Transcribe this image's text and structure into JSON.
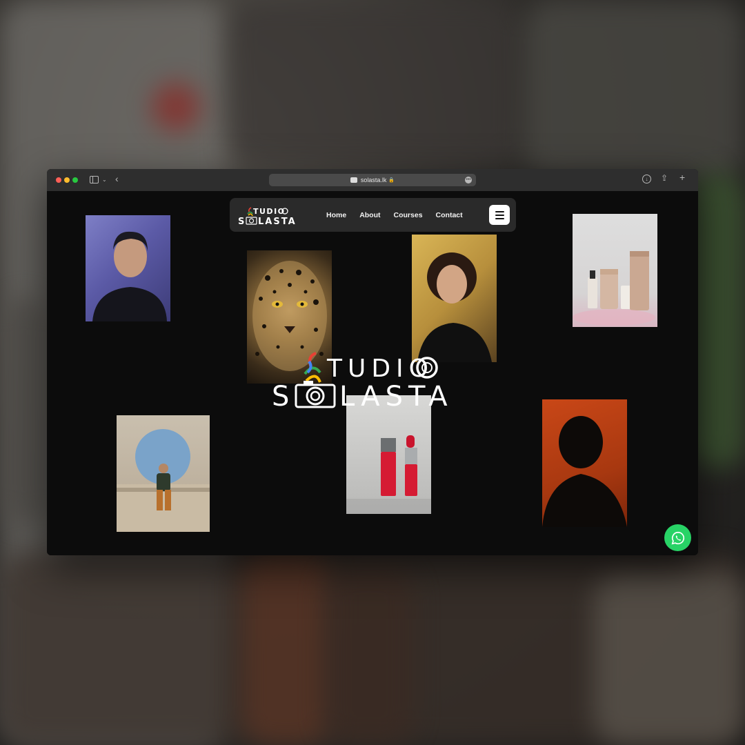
{
  "browser": {
    "url": "solasta.lk",
    "icons": {
      "sidebar": "sidebar-icon",
      "back": "chevron-left-icon",
      "download": "download-icon",
      "share": "share-icon",
      "new_tab": "plus-icon",
      "lock": "lock-icon",
      "more": "more-icon"
    }
  },
  "site": {
    "logo_text_top": "TUDIO",
    "logo_text_bottom": "LASTA",
    "logo_letter_s": "S",
    "nav": [
      {
        "label": "Home"
      },
      {
        "label": "About"
      },
      {
        "label": "Courses"
      },
      {
        "label": "Contact"
      }
    ],
    "menu_icon": "hamburger-icon",
    "whatsapp_icon": "whatsapp-icon",
    "colors": {
      "background": "#0c0c0c",
      "navbar": "#2a2a2a",
      "whatsapp": "#28d366"
    }
  },
  "gallery": [
    {
      "name": "portrait-woman-blue"
    },
    {
      "name": "leopard-closeup"
    },
    {
      "name": "portrait-woman-curly-hair"
    },
    {
      "name": "skincare-products"
    },
    {
      "name": "man-sitting-circle-window"
    },
    {
      "name": "lipstick-product"
    },
    {
      "name": "portrait-man-orange"
    }
  ]
}
